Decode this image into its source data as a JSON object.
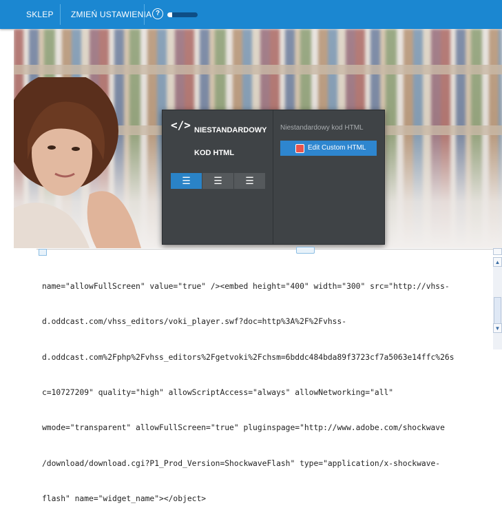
{
  "nav": {
    "shop": "SKLEP",
    "settings": "ZMIEŃ USTAWIENIA",
    "help_glyph": "?",
    "progress_fraction": 0.15
  },
  "panel": {
    "code_glyph": "</>",
    "title": "NIESTANDARDOWY KOD HTML",
    "align_icons": [
      "align-left-icon",
      "align-center-icon",
      "align-right-icon"
    ],
    "active_align": "left",
    "right_label": "Niestandardowy kod HTML",
    "edit_button": "Edit Custom HTML"
  },
  "editor": {
    "lines": [
      "name=\"allowFullScreen\" value=\"true\" /><embed height=\"400\" width=\"300\" src=\"http://vhss-",
      "d.oddcast.com/vhss_editors/voki_player.swf?doc=http%3A%2F%2Fvhss-",
      "d.oddcast.com%2Fphp%2Fvhss_editors%2Fgetvoki%2Fchsm=6bddc484bda89f3723cf7a5063e14ffc%26s",
      "c=10727209\" quality=\"high\" allowScriptAccess=\"always\" allowNetworking=\"all\"",
      "wmode=\"transparent\" allowFullScreen=\"true\" pluginspage=\"http://www.adobe.com/shockwave",
      "/download/download.cgi?P1_Prod_Version=ShockwaveFlash\" type=\"application/x-shockwave-",
      "flash\" name=\"widget_name\"></object>"
    ]
  },
  "colors": {
    "topbar": "#1b87d1",
    "panel": "#3f4346",
    "accent_button": "#2e86cf"
  }
}
